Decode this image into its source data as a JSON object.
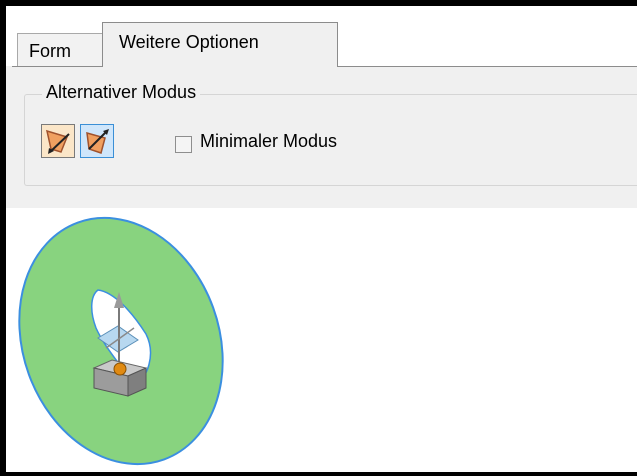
{
  "tabs": [
    {
      "label": "Form",
      "active": false
    },
    {
      "label": "Weitere Optionen",
      "active": true
    }
  ],
  "group": {
    "legend": "Alternativer Modus",
    "buttons": [
      {
        "icon": "shrink-mode-icon",
        "selected": false
      },
      {
        "icon": "expand-mode-icon",
        "selected": true
      }
    ],
    "checkbox": {
      "label": "Minimaler Modus",
      "checked": false
    }
  },
  "colors": {
    "ring_fill": "#88d37f",
    "ring_edge": "#3b8fe0",
    "selected_button_bg": "#cfe6fb"
  }
}
